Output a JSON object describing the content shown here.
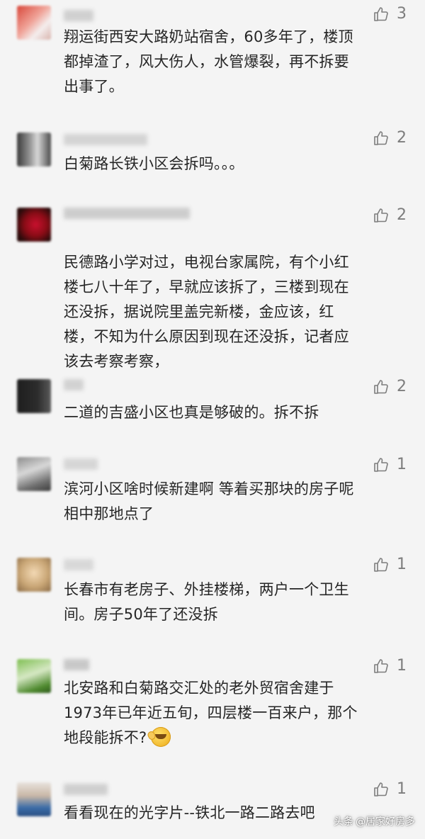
{
  "watermark": {
    "platform": "头条",
    "account": "@居家好房多"
  },
  "comments": [
    {
      "likes": "3",
      "text": "翔运街西安大路奶站宿舍，60多年了，楼顶\n都掉渣了，风大伤人，水管爆裂，再不拆要\n出事了。"
    },
    {
      "likes": "2",
      "text": "白菊路长铁小区会拆吗。。。"
    },
    {
      "likes": "2",
      "text": "民德路小学对过，电视台家属院，有个小红\n楼七八十年了，早就应该拆了，三楼到现在\n还没拆，据说院里盖完新楼，金应该，红\n楼，不知为什么原因到现在还没拆，记者应\n该去考察考察，"
    },
    {
      "likes": "2",
      "text": "二道的吉盛小区也真是够破的。拆不拆"
    },
    {
      "likes": "1",
      "text": "滨河小区啥时候新建啊 等着买那块的房子呢\n相中那地点了"
    },
    {
      "likes": "1",
      "text": "长春市有老房子、外挂楼梯，两户一个卫生\n间。房子50年了还没拆"
    },
    {
      "likes": "1",
      "text": "北安路和白菊路交汇处的老外贸宿舍建于\n1973年已年近五旬，四层楼一百来户，那个\n地段能拆不?",
      "emoji": "grimace-emoji"
    },
    {
      "likes": "1",
      "text": "看看现在的光字片--铁北一路二路去吧"
    }
  ]
}
